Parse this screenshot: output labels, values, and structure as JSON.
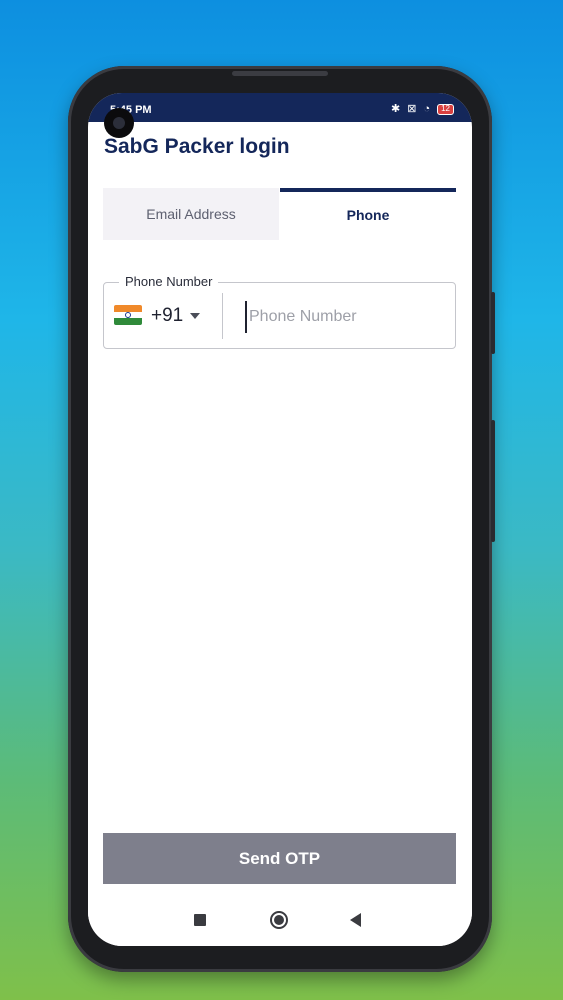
{
  "status_bar": {
    "time": "5:45 PM",
    "battery": "12",
    "icons": [
      "bluetooth-icon",
      "no-sim-icon",
      "wifi-icon",
      "battery-icon"
    ]
  },
  "screen": {
    "title": "SabG Packer login",
    "tabs": [
      {
        "label": "Email Address",
        "selected": false
      },
      {
        "label": "Phone",
        "selected": true
      }
    ],
    "phone_field": {
      "label": "Phone Number",
      "country_code": "+91",
      "country_flag": "india-flag-icon",
      "value": "",
      "placeholder": "Phone Number"
    },
    "send_button": "Send OTP"
  },
  "colors": {
    "primary": "#14275a",
    "button_disabled": "#7e7f8c",
    "tab_inactive_bg": "#f3f2f6"
  }
}
